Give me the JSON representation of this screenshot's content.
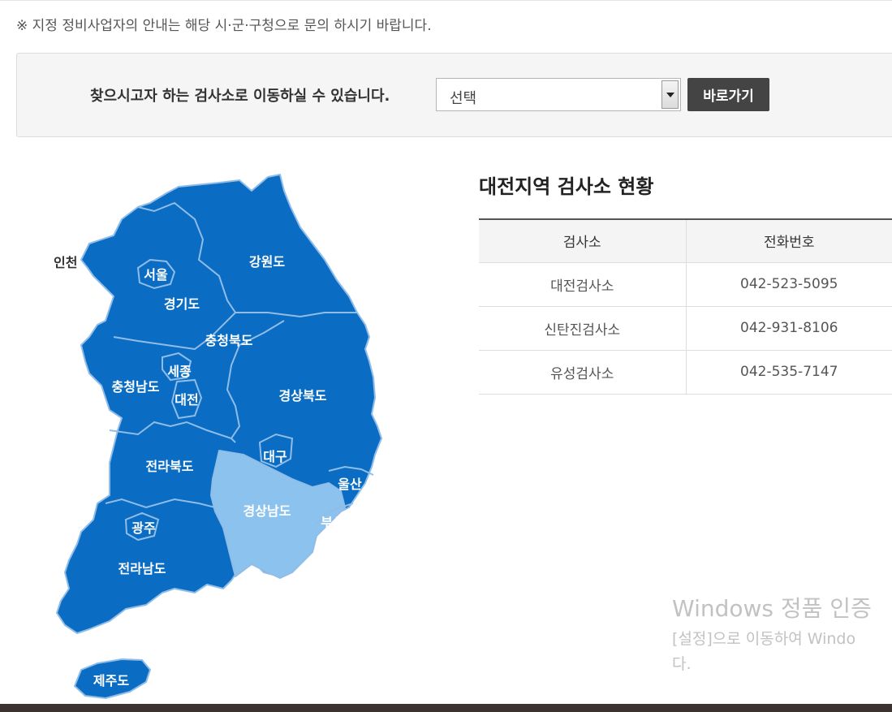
{
  "notice": "※ 지정 정비사업자의 안내는 해당 시·군·구청으로 문의 하시기 바랍니다.",
  "selector": {
    "label": "찾으시고자 하는 검사소로 이동하실 수 있습니다.",
    "selected_value": "선택",
    "go_label": "바로가기"
  },
  "map": {
    "regions": {
      "incheon": "인천",
      "seoul": "서울",
      "gyeonggi": "경기도",
      "gangwon": "강원도",
      "chungbuk": "충청북도",
      "sejong": "세종",
      "chungnam": "충청남도",
      "daejeon": "대전",
      "gyeongbuk": "경상북도",
      "daegu": "대구",
      "jeonbuk": "전라북도",
      "ulsan": "울산",
      "gyeongnam": "경상남도",
      "busan": "부산",
      "gwangju": "광주",
      "jeonnam": "전라남도",
      "jeju": "제주도"
    },
    "active_region": "경상남도",
    "colors": {
      "region": "#0a6cc3",
      "active": "#8cc3ee",
      "border": "#8fbde8"
    }
  },
  "status": {
    "title": "대전지역 검사소 현황",
    "headers": [
      "검사소",
      "전화번호"
    ],
    "rows": [
      [
        "대전검사소",
        "042-523-5095"
      ],
      [
        "신탄진검사소",
        "042-931-8106"
      ],
      [
        "유성검사소",
        "042-535-7147"
      ]
    ]
  },
  "watermark": {
    "title": "Windows 정품 인증",
    "line1": "[설정]으로 이동하여 Windo",
    "line2": "다."
  }
}
